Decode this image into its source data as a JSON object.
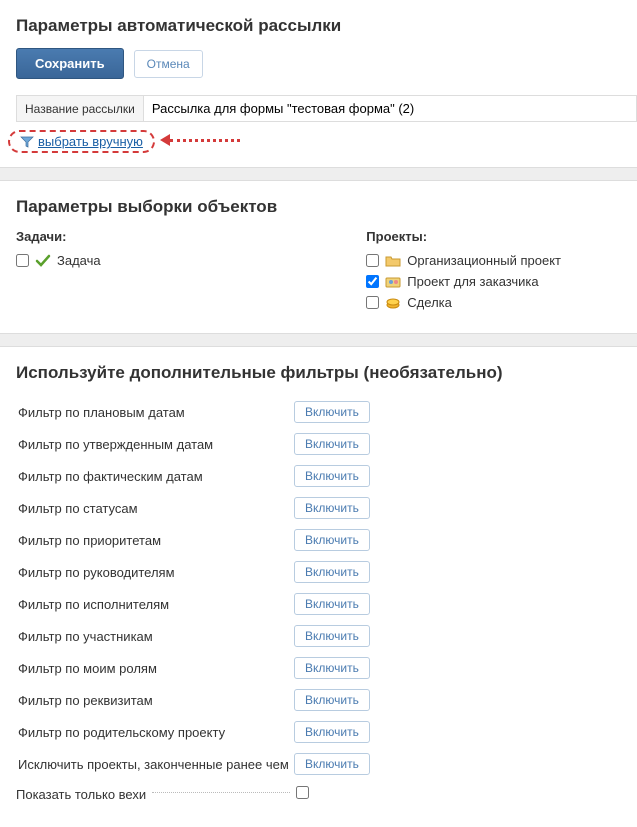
{
  "header": {
    "title": "Параметры автоматической рассылки",
    "save_label": "Сохранить",
    "cancel_label": "Отмена"
  },
  "name_field": {
    "label": "Название рассылки",
    "value": "Рассылка для формы \"тестовая форма\" (2)"
  },
  "manual": {
    "link_text": "выбрать вручную"
  },
  "selection": {
    "title": "Параметры выборки объектов",
    "tasks_title": "Задачи:",
    "projects_title": "Проекты:",
    "tasks": [
      {
        "label": "Задача",
        "checked": false
      }
    ],
    "projects": [
      {
        "label": "Организационный проект",
        "checked": false
      },
      {
        "label": "Проект для заказчика",
        "checked": true
      },
      {
        "label": "Сделка",
        "checked": false
      }
    ]
  },
  "filters": {
    "title": "Используйте дополнительные фильтры (необязательно)",
    "enable_label": "Включить",
    "items": [
      "Фильтр по плановым датам",
      "Фильтр по утвержденным датам",
      "Фильтр по фактическим датам",
      "Фильтр по статусам",
      "Фильтр по приоритетам",
      "Фильтр по руководителям",
      "Фильтр по исполнителям",
      "Фильтр по участникам",
      "Фильтр по моим ролям",
      "Фильтр по реквизитам",
      "Фильтр по родительскому проекту",
      "Исключить проекты, законченные ранее чем"
    ],
    "milestones_label": "Показать только вехи",
    "milestones_checked": false
  }
}
